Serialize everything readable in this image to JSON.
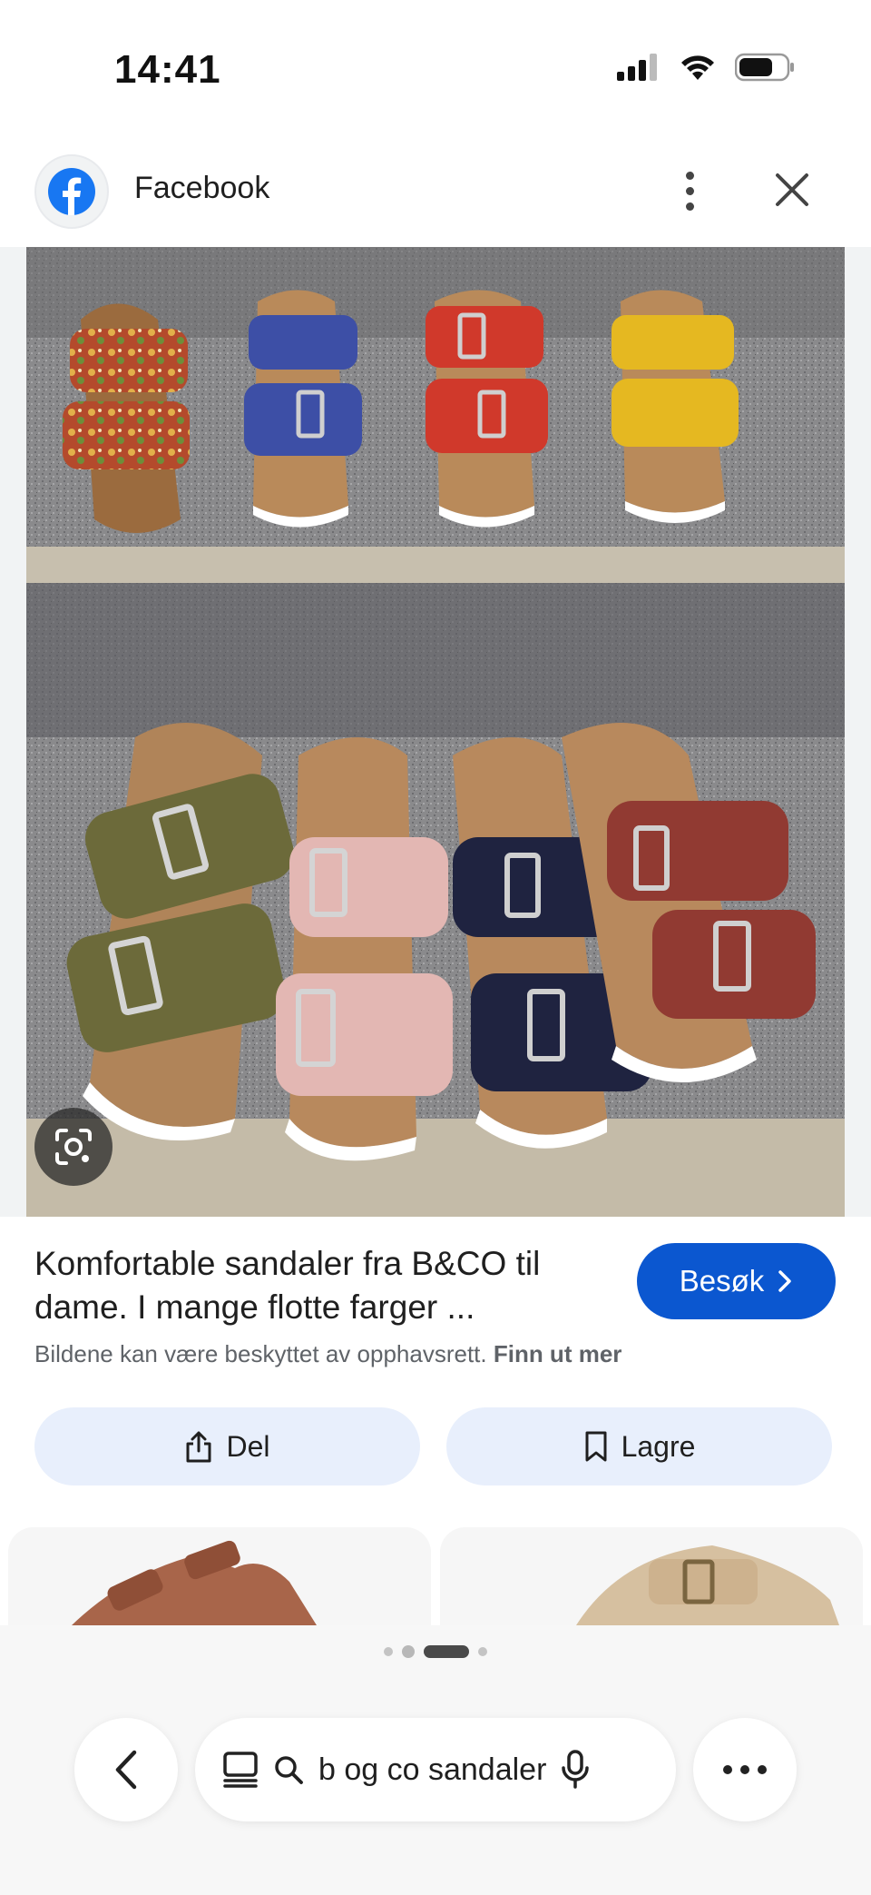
{
  "status_bar": {
    "time": "14:41"
  },
  "header": {
    "site_name": "Facebook",
    "icons": [
      "facebook-logo-icon",
      "more-vert-icon",
      "close-icon"
    ]
  },
  "image_viewer": {
    "lens_icon": "google-lens-icon",
    "colors": {
      "accent": "#0b57d0",
      "button_tint": "#e8effc"
    }
  },
  "result": {
    "title": "Komfortable sandaler fra B&CO til dame. I mange flotte farger ...",
    "visit_label": "Besøk",
    "copyright_text": "Bildene kan være beskyttet av opphavsrett.",
    "learn_more_label": "Finn ut mer"
  },
  "actions": {
    "share_label": "Del",
    "save_label": "Lagre"
  },
  "search": {
    "query": "b og co sandaler"
  }
}
